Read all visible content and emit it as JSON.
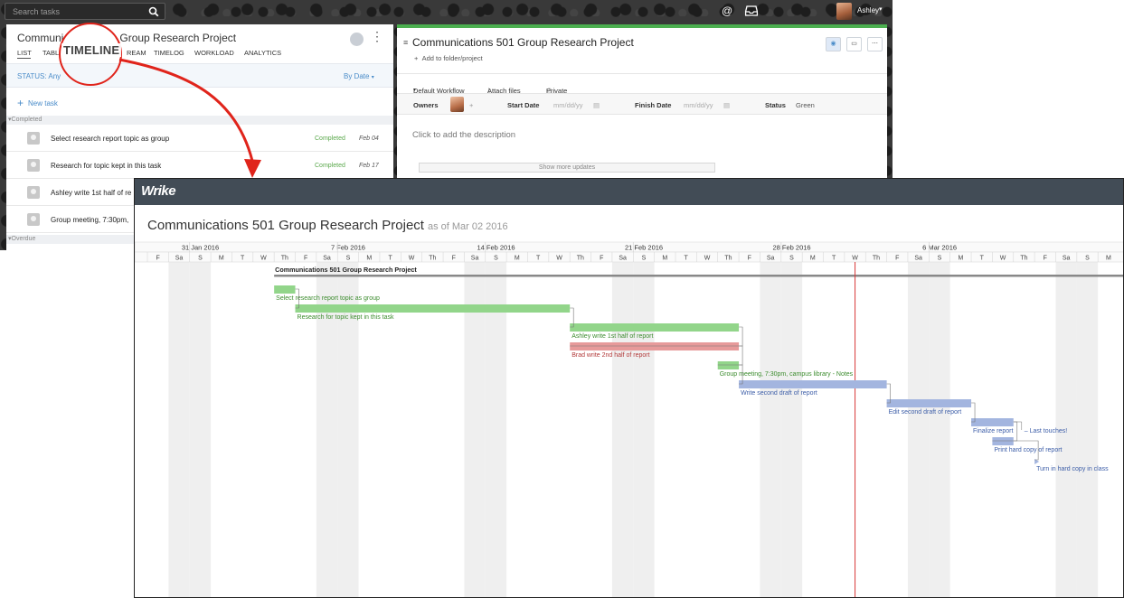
{
  "topbar": {
    "search_placeholder": "Search tasks",
    "mention_icon": "@",
    "inbox_icon": "inbox-icon",
    "user_name": "Ashley"
  },
  "task_panel": {
    "title_part1": "Communi",
    "title_part2": "Group Research Project",
    "tabs": [
      "LIST",
      "TABL",
      "REAM",
      "TIMELOG",
      "WORKLOAD",
      "ANALYTICS"
    ],
    "status_filter": "STATUS: Any",
    "sort": "By Date",
    "new_task": "New task",
    "sections": {
      "completed": "Completed",
      "overdue": "Overdue"
    },
    "tasks": [
      {
        "name": "Select research report topic as group",
        "status": "Completed",
        "date": "Feb 04"
      },
      {
        "name": "Research for topic kept in this task",
        "status": "Completed",
        "date": "Feb 17"
      },
      {
        "name": "Ashley write 1st half of re",
        "status": "",
        "date": ""
      },
      {
        "name": "Group meeting, 7:30pm,",
        "status": "",
        "date": ""
      }
    ]
  },
  "detail_panel": {
    "title": "Communications 501 Group Research Project",
    "add_to_folder": "Add to folder/project",
    "workflow": "Default Workflow",
    "attach": "Attach files",
    "privacy": "Private",
    "owners_label": "Owners",
    "start_label": "Start Date",
    "start_placeholder": "mm/dd/yy",
    "finish_label": "Finish Date",
    "finish_placeholder": "mm/dd/yy",
    "status_label": "Status",
    "status_value": "Green",
    "description_placeholder": "Click to add the description",
    "show_more": "Show more updates",
    "accent_color": "#4caf50"
  },
  "callout": {
    "label": "TIMELINE",
    "color": "#e0241b"
  },
  "timeline": {
    "logo": "Wrike",
    "title": "Communications 501 Group Research Project",
    "as_of": "as of Mar 02 2016",
    "weeks": [
      "31 Jan 2016",
      "7 Feb 2016",
      "14 Feb 2016",
      "21 Feb 2016",
      "28 Feb 2016",
      "6 Mar 2016"
    ],
    "day_labels": [
      "F",
      "Sa",
      "S",
      "M",
      "T",
      "W",
      "Th",
      "F",
      "Sa",
      "S",
      "M",
      "T",
      "W",
      "Th",
      "F",
      "Sa",
      "S",
      "M",
      "T",
      "W",
      "Th",
      "F",
      "Sa",
      "S",
      "M",
      "T",
      "W",
      "Th",
      "F",
      "Sa",
      "S",
      "M",
      "T",
      "W",
      "Th",
      "F",
      "Sa",
      "S",
      "M",
      "T",
      "W",
      "Th",
      "F",
      "Sa",
      "S",
      "M"
    ],
    "today_index": 33,
    "project_name": "Communications 501 Group Research Project",
    "tasks": [
      {
        "name": "Select research report topic as group",
        "start": 6.0,
        "end": 7.0,
        "color": "green"
      },
      {
        "name": "Research for topic kept in this task",
        "start": 7.0,
        "end": 20.0,
        "color": "green"
      },
      {
        "name": "Ashley write 1st half of report",
        "start": 20.0,
        "end": 28.0,
        "color": "green"
      },
      {
        "name": "Brad write 2nd half of report",
        "start": 20.0,
        "end": 28.0,
        "color": "red"
      },
      {
        "name": "Group meeting, 7:30pm, campus library - Notes",
        "start": 27.0,
        "end": 28.0,
        "color": "green"
      },
      {
        "name": "Write second draft of report",
        "start": 28.0,
        "end": 35.0,
        "color": "blue"
      },
      {
        "name": "Edit second draft of report",
        "start": 35.0,
        "end": 39.0,
        "color": "blue"
      },
      {
        "name": "Finalize report",
        "note": "Last touches!",
        "start": 39.0,
        "end": 41.0,
        "color": "blue"
      },
      {
        "name": "Print hard copy of report",
        "start": 40.0,
        "end": 41.0,
        "color": "blue"
      },
      {
        "name": "Turn in hard copy in class",
        "start": 42.0,
        "end": 42.0,
        "color": "blue",
        "milestone": true
      }
    ],
    "colors": {
      "green_fill": "#92d58a",
      "green_text": "#3c8c2e",
      "red_fill": "#e79a9a",
      "red_text": "#b23a3a",
      "blue_fill": "#a3b5df",
      "blue_text": "#3d5ea8",
      "today_line": "#d93838",
      "weekend": "#efefef"
    }
  }
}
